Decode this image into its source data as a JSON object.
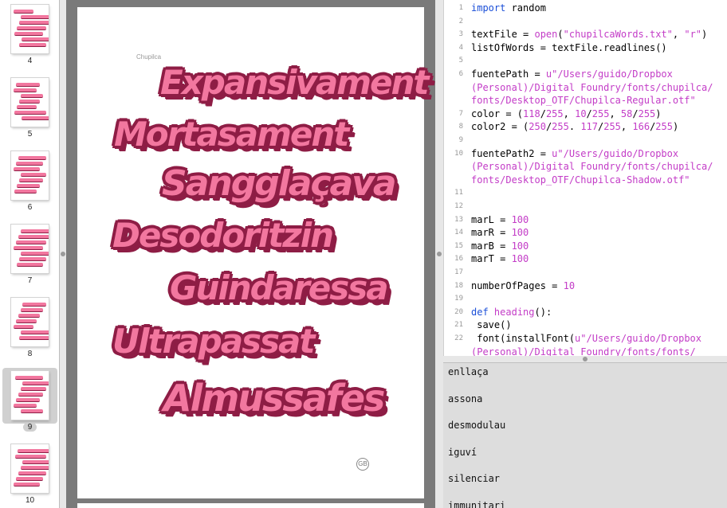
{
  "thumbnails": [
    {
      "number": "4",
      "selected": false
    },
    {
      "number": "5",
      "selected": false
    },
    {
      "number": "6",
      "selected": false
    },
    {
      "number": "7",
      "selected": false
    },
    {
      "number": "8",
      "selected": false
    },
    {
      "number": "9",
      "selected": true
    },
    {
      "number": "10",
      "selected": false
    }
  ],
  "pdf": {
    "heading": "Chupilca",
    "words": [
      "Expansivament",
      "Mortasament",
      "Sangglaçava",
      "Desodoritzin",
      "Guindaressa",
      "Ultrapassat",
      "Almussafes"
    ],
    "logo": "GB"
  },
  "code_lines": [
    {
      "n": "1",
      "parts": [
        [
          "kw",
          "import"
        ],
        [
          "p",
          " random"
        ]
      ]
    },
    {
      "n": "2",
      "parts": []
    },
    {
      "n": "3",
      "parts": [
        [
          "p",
          "textFile = "
        ],
        [
          "builtin",
          "open"
        ],
        [
          "p",
          "("
        ],
        [
          "str",
          "\"chupilcaWords.txt\""
        ],
        [
          "p",
          ", "
        ],
        [
          "str",
          "\"r\""
        ],
        [
          "p",
          ")"
        ]
      ]
    },
    {
      "n": "4",
      "parts": [
        [
          "p",
          "listOfWords = textFile.readlines()"
        ]
      ]
    },
    {
      "n": "5",
      "parts": []
    },
    {
      "n": "6",
      "parts": [
        [
          "p",
          "fuentePath = "
        ],
        [
          "str",
          "u\"/Users/guido/Dropbox"
        ]
      ]
    },
    {
      "n": "",
      "parts": [
        [
          "str",
          "(Personal)/Digital Foundry/fonts/chupilca/"
        ]
      ]
    },
    {
      "n": "",
      "parts": [
        [
          "str",
          "fonts/Desktop_OTF/Chupilca-Regular.otf\""
        ]
      ]
    },
    {
      "n": "7",
      "parts": [
        [
          "p",
          "color = ("
        ],
        [
          "num",
          "118"
        ],
        [
          "p",
          "/"
        ],
        [
          "num",
          "255"
        ],
        [
          "p",
          ", "
        ],
        [
          "num",
          "10"
        ],
        [
          "p",
          "/"
        ],
        [
          "num",
          "255"
        ],
        [
          "p",
          ", "
        ],
        [
          "num",
          "58"
        ],
        [
          "p",
          "/"
        ],
        [
          "num",
          "255"
        ],
        [
          "p",
          ")"
        ]
      ]
    },
    {
      "n": "8",
      "parts": [
        [
          "p",
          "color2 = ("
        ],
        [
          "num",
          "250"
        ],
        [
          "p",
          "/"
        ],
        [
          "num",
          "255"
        ],
        [
          "p",
          ". "
        ],
        [
          "num",
          "117"
        ],
        [
          "p",
          "/"
        ],
        [
          "num",
          "255"
        ],
        [
          "p",
          ", "
        ],
        [
          "num",
          "166"
        ],
        [
          "p",
          "/"
        ],
        [
          "num",
          "255"
        ],
        [
          "p",
          ")"
        ]
      ]
    },
    {
      "n": "9",
      "parts": []
    },
    {
      "n": "10",
      "parts": [
        [
          "p",
          "fuentePath2 = "
        ],
        [
          "str",
          "u\"/Users/guido/Dropbox"
        ]
      ]
    },
    {
      "n": "",
      "parts": [
        [
          "str",
          "(Personal)/Digital Foundry/fonts/chupilca/"
        ]
      ]
    },
    {
      "n": "",
      "parts": [
        [
          "str",
          "fonts/Desktop_OTF/Chupilca-Shadow.otf\""
        ]
      ]
    },
    {
      "n": "11",
      "parts": []
    },
    {
      "n": "12",
      "parts": []
    },
    {
      "n": "13",
      "parts": [
        [
          "p",
          "marL = "
        ],
        [
          "num",
          "100"
        ]
      ]
    },
    {
      "n": "14",
      "parts": [
        [
          "p",
          "marR = "
        ],
        [
          "num",
          "100"
        ]
      ]
    },
    {
      "n": "15",
      "parts": [
        [
          "p",
          "marB = "
        ],
        [
          "num",
          "100"
        ]
      ]
    },
    {
      "n": "16",
      "parts": [
        [
          "p",
          "marT = "
        ],
        [
          "num",
          "100"
        ]
      ]
    },
    {
      "n": "17",
      "parts": []
    },
    {
      "n": "18",
      "parts": [
        [
          "p",
          "numberOfPages = "
        ],
        [
          "num",
          "10"
        ]
      ]
    },
    {
      "n": "19",
      "parts": []
    },
    {
      "n": "20",
      "parts": [
        [
          "kw",
          "def"
        ],
        [
          "p",
          " "
        ],
        [
          "builtin",
          "heading"
        ],
        [
          "p",
          "():"
        ]
      ]
    },
    {
      "n": "21",
      "parts": [
        [
          "p",
          "    save()"
        ]
      ]
    },
    {
      "n": "22",
      "parts": [
        [
          "p",
          "    font(installFont("
        ],
        [
          "str",
          "u\"/Users/guido/Dropbox"
        ]
      ]
    },
    {
      "n": "",
      "parts": [
        [
          "str",
          "(Personal)/Digital Foundry/fonts/fonts/"
        ]
      ]
    }
  ],
  "console_lines": [
    "enllaça",
    "assona",
    "desmodulau",
    "iguví",
    "silenciar",
    "immunitari"
  ],
  "colors": {
    "pink": "#f2779f",
    "maroon": "#8e1d45",
    "keyword": "#1b4fd8",
    "string": "#c33cc7"
  }
}
